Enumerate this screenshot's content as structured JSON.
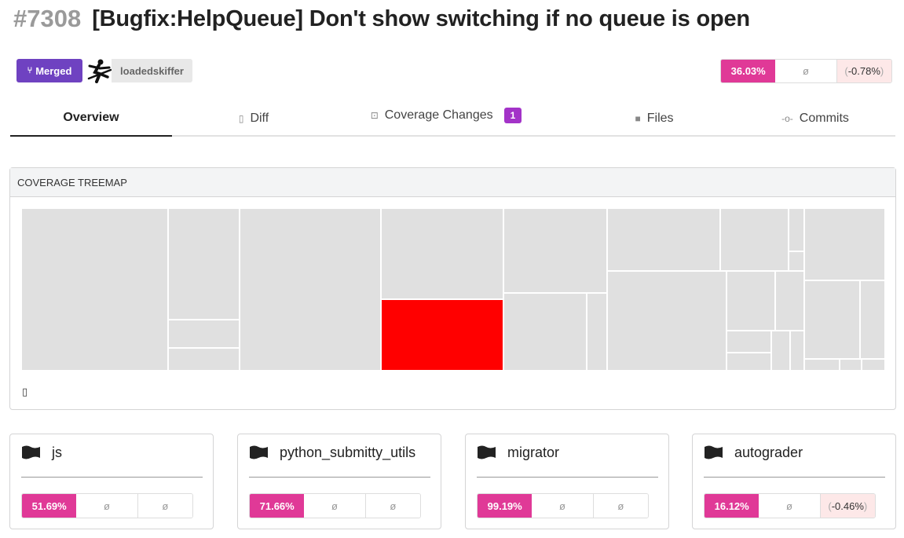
{
  "header": {
    "pr_number": "#7308",
    "pr_title": "[Bugfix:HelpQueue] Don't show switching if no queue is open",
    "status": "Merged",
    "author": "loadedskiffer"
  },
  "coverage_summary": {
    "percent": "36.03%",
    "placeholder": "ø",
    "change": "-0.78%",
    "paren_open": "(",
    "paren_close": ")"
  },
  "tabs": [
    {
      "label": "Overview",
      "icon": "none"
    },
    {
      "label": "Diff",
      "icon": "file-diff-icon"
    },
    {
      "label": "Coverage Changes",
      "icon": "target-icon",
      "badge": "1"
    },
    {
      "label": "Files",
      "icon": "folder-icon"
    },
    {
      "label": "Commits",
      "icon": "commit-icon"
    }
  ],
  "treemap": {
    "title": "COVERAGE TREEMAP",
    "colors": {
      "default": "#e0e0e0",
      "highlight": "#ff0000",
      "border": "#ffffff"
    }
  },
  "flags": [
    {
      "name": "js",
      "percent": "51.69%",
      "col2": "ø",
      "col3": "ø"
    },
    {
      "name": "python_submitty_utils",
      "percent": "71.66%",
      "col2": "ø",
      "col3": "ø"
    },
    {
      "name": "migrator",
      "percent": "99.19%",
      "col2": "ø",
      "col3": "ø"
    },
    {
      "name": "autograder",
      "percent": "16.12%",
      "col2": "ø",
      "col3": "-0.46%"
    }
  ],
  "colors": {
    "merged": "#6f42c1",
    "coverage_pink": "#e03997",
    "badge_purple": "#a333c8",
    "negative_bg": "#fde8e8"
  }
}
